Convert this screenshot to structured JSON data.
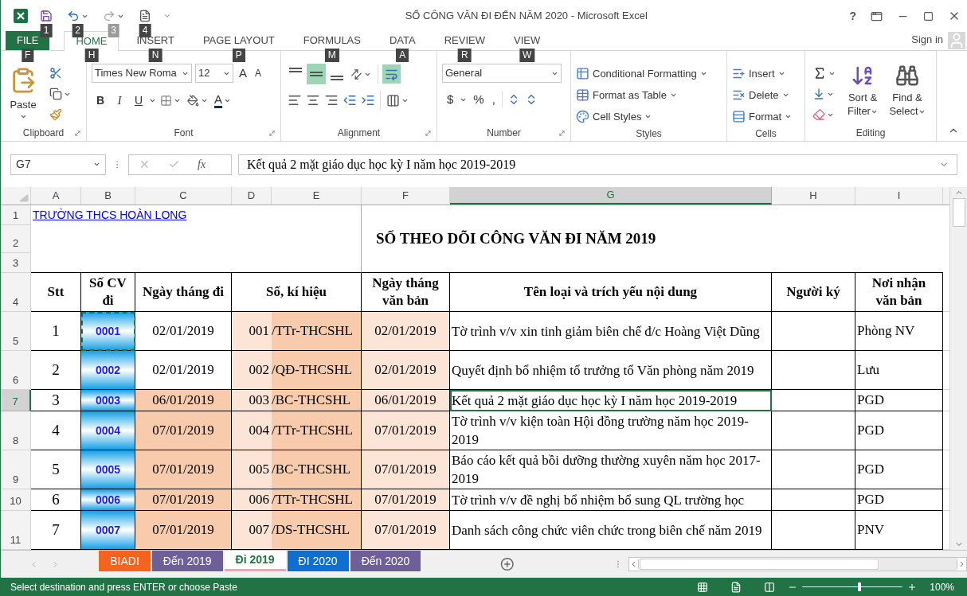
{
  "window": {
    "title": "SỔ CÔNG VĂN ĐI ĐẾN NĂM 2020 - Microsoft Excel",
    "help": "?",
    "sign_in": "Sign in"
  },
  "quick_access": [
    {
      "kind": "save",
      "key_tip": "1",
      "disabled": false
    },
    {
      "kind": "undo",
      "key_tip": "2",
      "disabled": false
    },
    {
      "kind": "redo",
      "key_tip": "3",
      "disabled": true
    },
    {
      "kind": "touch",
      "key_tip": "4",
      "disabled": false
    }
  ],
  "ribbon_tabs": [
    {
      "label": "FILE",
      "key_tip": "F",
      "kind": "file",
      "selected": false
    },
    {
      "label": "HOME",
      "key_tip": "H",
      "kind": "tab",
      "selected": true
    },
    {
      "label": "INSERT",
      "key_tip": "N",
      "kind": "tab",
      "selected": false
    },
    {
      "label": "PAGE LAYOUT",
      "key_tip": "P",
      "kind": "tab",
      "selected": false
    },
    {
      "label": "FORMULAS",
      "key_tip": "M",
      "kind": "tab",
      "selected": false
    },
    {
      "label": "DATA",
      "key_tip": "A",
      "kind": "tab",
      "selected": false
    },
    {
      "label": "REVIEW",
      "key_tip": "R",
      "kind": "tab",
      "selected": false
    },
    {
      "label": "VIEW",
      "key_tip": "W",
      "kind": "tab",
      "selected": false
    }
  ],
  "clipboard": {
    "label": "Clipboard",
    "paste": "Paste"
  },
  "font": {
    "label": "Font",
    "name": "Times New Roma",
    "size": "12",
    "grow": "A",
    "shrink": "A",
    "styles": [
      "B",
      "I",
      "U"
    ],
    "font_color": "A"
  },
  "alignment": {
    "label": "Alignment",
    "vertical": [
      {
        "selected": false
      },
      {
        "selected": true
      },
      {
        "selected": false
      }
    ],
    "wrap_text": true
  },
  "number": {
    "label": "Number",
    "format": "General",
    "symbols": [
      "$",
      "%",
      ","
    ]
  },
  "styles": {
    "label": "Styles",
    "commands": [
      "Conditional Formatting",
      "Format as Table",
      "Cell Styles"
    ]
  },
  "cells": {
    "label": "Cells",
    "commands": [
      "Insert",
      "Delete",
      "Format"
    ]
  },
  "editing": {
    "label": "Editing",
    "commands": [
      [
        "Sort &",
        "Filter"
      ],
      [
        "Find &",
        "Select"
      ]
    ]
  },
  "formula_bar": {
    "name_box": "G7",
    "function_label": "fx",
    "formula": "Kết quả 2 mặt giáo dục học kỳ I năm học 2019-2019"
  },
  "columns": [
    {
      "label": "A",
      "selected": false
    },
    {
      "label": "B",
      "selected": false
    },
    {
      "label": "C",
      "selected": false
    },
    {
      "label": "D",
      "selected": false
    },
    {
      "label": "E",
      "selected": false
    },
    {
      "label": "F",
      "selected": false
    },
    {
      "label": "G",
      "selected": true
    },
    {
      "label": "H",
      "selected": false
    },
    {
      "label": "I",
      "selected": false
    }
  ],
  "header_row_numbers": [
    "1",
    "2",
    "3",
    "4"
  ],
  "school_link": "TRƯỜNG THCS HOÀN LONG",
  "sheet_title": "SỔ THEO DÕI CÔNG VĂN ĐI NĂM 2019",
  "table_headers": [
    "Stt",
    "Số CV đi",
    "Ngày tháng đi",
    "Số, kí hiệu",
    "Ngày tháng văn bản",
    "Tên loại và trích yếu nội dung",
    "Người ký",
    "Nơi nhận văn bản"
  ],
  "rows": [
    {
      "row_number": "5",
      "stt": "1",
      "so_cv": "0001",
      "ngay_di": "02/01/2019",
      "so": "001",
      "ki_hieu": "/TTr-THCSHL",
      "ngay_vb": "02/01/2019",
      "noi_dung": "Tờ trình v/v xin tinh giảm biên chế đ/c Hoàng Việt Dũng",
      "noi_nhan": "Phòng NV",
      "date_highlight": false,
      "copy_marquee": true,
      "selected": false
    },
    {
      "row_number": "6",
      "stt": "2",
      "so_cv": "0002",
      "ngay_di": "02/01/2019",
      "so": "002",
      "ki_hieu": "/QĐ-THCSHL",
      "ngay_vb": "02/01/2019",
      "noi_dung": "Quyết định bổ nhiệm tổ trưởng tổ Văn phòng năm 2019",
      "noi_nhan": "Lưu",
      "date_highlight": false,
      "copy_marquee": false,
      "selected": false
    },
    {
      "row_number": "7",
      "stt": "3",
      "so_cv": "0003",
      "ngay_di": "06/01/2019",
      "so": "003",
      "ki_hieu": "/BC-THCSHL",
      "ngay_vb": "06/01/2019",
      "noi_dung": "Kết quả 2 mặt giáo dục học kỳ I năm học 2019-2019",
      "noi_nhan": "PGD",
      "date_highlight": true,
      "copy_marquee": false,
      "selected": true
    },
    {
      "row_number": "8",
      "stt": "4",
      "so_cv": "0004",
      "ngay_di": "07/01/2019",
      "so": "004",
      "ki_hieu": "/TTr-THCSHL",
      "ngay_vb": "07/01/2019",
      "noi_dung": "Tờ trình v/v kiện toàn Hội đồng trường năm học 2019-2019",
      "noi_nhan": "PGD",
      "date_highlight": true,
      "copy_marquee": false,
      "selected": false
    },
    {
      "row_number": "9",
      "stt": "5",
      "so_cv": "0005",
      "ngay_di": "07/01/2019",
      "so": "005",
      "ki_hieu": "/BC-THCSHL",
      "ngay_vb": "07/01/2019",
      "noi_dung": "Báo cáo kết quả bồi dưỡng thường xuyên năm học 2017-2019",
      "noi_nhan": "PGD",
      "date_highlight": true,
      "copy_marquee": false,
      "selected": false
    },
    {
      "row_number": "10",
      "stt": "6",
      "so_cv": "0006",
      "ngay_di": "07/01/2019",
      "so": "006",
      "ki_hieu": "/TTr-THCSHL",
      "ngay_vb": "07/01/2019",
      "noi_dung": "Tờ trình v/v đề nghị bổ nhiệm bổ sung QL trường học",
      "noi_nhan": "PGD",
      "date_highlight": true,
      "copy_marquee": false,
      "selected": false
    },
    {
      "row_number": "11",
      "stt": "7",
      "so_cv": "0007",
      "ngay_di": "07/01/2019",
      "so": "007",
      "ki_hieu": "/DS-THCSHL",
      "ngay_vb": "07/01/2019",
      "noi_dung": "Danh sách công chức viên chức trong biên chế năm 2019",
      "noi_nhan": "PNV",
      "date_highlight": true,
      "copy_marquee": false,
      "selected": false
    }
  ],
  "sheet_tabs": [
    {
      "label": "BIADI",
      "color": "#f5641e",
      "selected": false
    },
    {
      "label": "Đến 2019",
      "color": "#6e5f99",
      "selected": false
    },
    {
      "label": "Đi 2019",
      "color": "#f4a3b4",
      "selected": true
    },
    {
      "label": "ĐI 2020",
      "color": "#0e6fd1",
      "selected": false
    },
    {
      "label": "Đến 2020",
      "color": "#6e5f99",
      "selected": false
    }
  ],
  "status_bar": {
    "message": "Select destination and press ENTER or choose Paste",
    "zoom_slider": {
      "level": 0.55
    },
    "zoom": "100%"
  }
}
